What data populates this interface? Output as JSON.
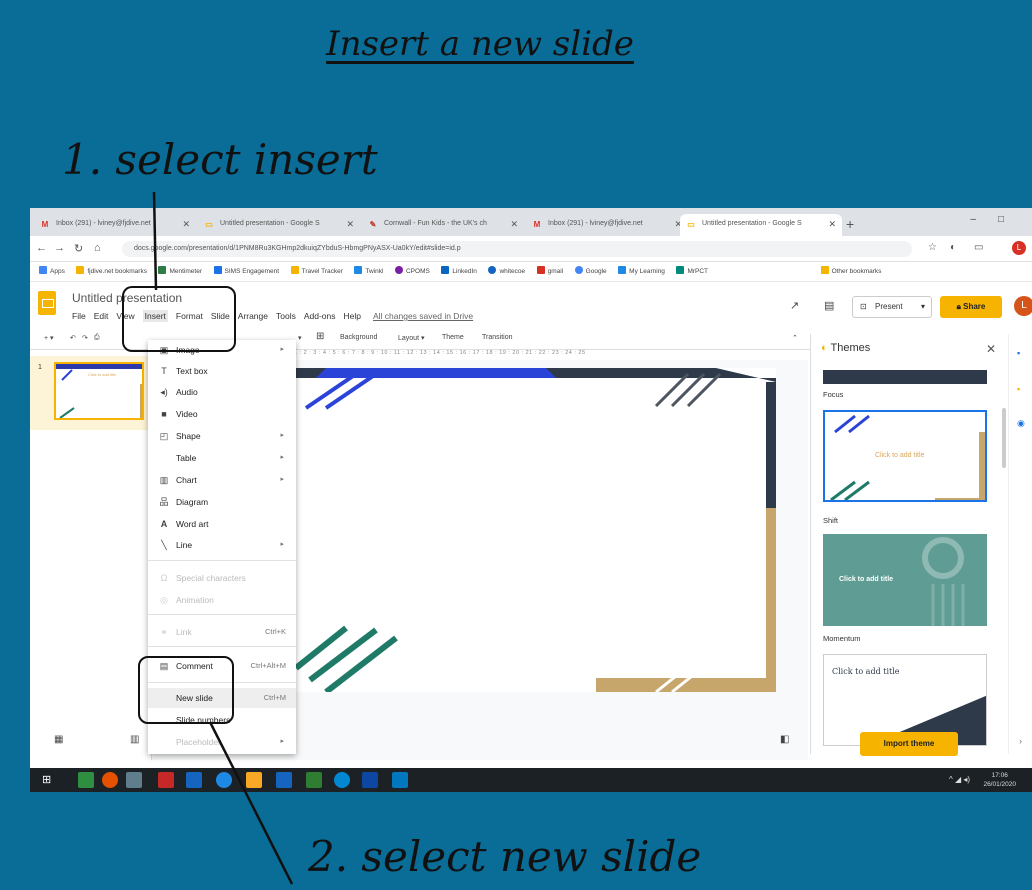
{
  "instructions": {
    "title": "Insert a new slide",
    "step1": "1. select insert",
    "step2": "2. select new slide"
  },
  "browser": {
    "tabs": [
      {
        "label": "Inbox (291) - lviney@fjdive.net",
        "icon": "M",
        "color": "#d93025"
      },
      {
        "label": "Untitled presentation - Google S",
        "icon": "▭",
        "color": "#f4b400"
      },
      {
        "label": "Cornwall - Fun Kids - the UK's ch",
        "icon": "✎",
        "color": "#c0392b"
      },
      {
        "label": "Inbox (291) - lviney@fjdive.net",
        "icon": "M",
        "color": "#d93025"
      },
      {
        "label": "Untitled presentation - Google S",
        "icon": "▭",
        "color": "#f4b400"
      }
    ],
    "url": "docs.google.com/presentation/d/1PNM8Ru3KGHmp2dkuiqZYbduS-HbmgPNyASX-Ua0kY/edit#slide=id.p",
    "bookmarks": [
      {
        "label": "Apps",
        "color": "#4285f4"
      },
      {
        "label": "fjdive.net bookmarks",
        "color": "#f4b400"
      },
      {
        "label": "Mentimeter",
        "color": "#2d7d46"
      },
      {
        "label": "SIMS Engagement",
        "color": "#1a73e8"
      },
      {
        "label": "Travel Tracker",
        "color": "#f4b400"
      },
      {
        "label": "Twinkl",
        "color": "#1e88e5"
      },
      {
        "label": "CPOMS",
        "color": "#7b1fa2"
      },
      {
        "label": "LinkedIn",
        "color": "#0a66c2"
      },
      {
        "label": "whitecoe",
        "color": "#1565c0"
      },
      {
        "label": "gmail",
        "color": "#d93025"
      },
      {
        "label": "Google",
        "color": "#4285f4"
      },
      {
        "label": "My Learning",
        "color": "#1e88e5"
      },
      {
        "label": "MrPCT",
        "color": "#00897b"
      }
    ],
    "other_bookmarks": "Other bookmarks"
  },
  "doc": {
    "title": "Untitled presentation",
    "menus": [
      "File",
      "Edit",
      "View",
      "Insert",
      "Format",
      "Slide",
      "Arrange",
      "Tools",
      "Add-ons",
      "Help"
    ],
    "saved": "All changes saved in Drive",
    "present": "Present",
    "share": "Share",
    "avatar": "L"
  },
  "toolbar": {
    "background": "Background",
    "layout": "Layout ▾",
    "theme": "Theme",
    "transition": "Transition"
  },
  "ruler": "1 : 2 : 3 : 4 : 5 : 6 : 7 : 8 : 9 : 10 : 11 : 12 : 13 : 14 : 15 : 16 : 17 : 18 : 19 : 20 : 21 : 22 : 23 : 24 : 25",
  "filmstrip": {
    "slide_number": "1",
    "thumb_text": "Click to add title"
  },
  "insert_menu": {
    "image": "Image",
    "text_box": "Text box",
    "audio": "Audio",
    "video": "Video",
    "shape": "Shape",
    "table": "Table",
    "chart": "Chart",
    "diagram": "Diagram",
    "word_art": "Word art",
    "line": "Line",
    "special_characters": "Special characters",
    "animation": "Animation",
    "link": "Link",
    "link_shortcut": "Ctrl+K",
    "comment": "Comment",
    "comment_shortcut": "Ctrl+Alt+M",
    "new_slide": "New slide",
    "new_slide_shortcut": "Ctrl+M",
    "slide_numbers": "Slide numbers",
    "placeholder": "Placeholder"
  },
  "themes": {
    "heading": "Themes",
    "items": [
      "Focus",
      "Shift",
      "Momentum"
    ],
    "shift_text": "Click to add title",
    "momentum_text": "Click to add title",
    "last_text": "Click to add title",
    "import": "Import theme"
  },
  "taskbar": {
    "time": "17:06",
    "date": "26/01/2020"
  }
}
